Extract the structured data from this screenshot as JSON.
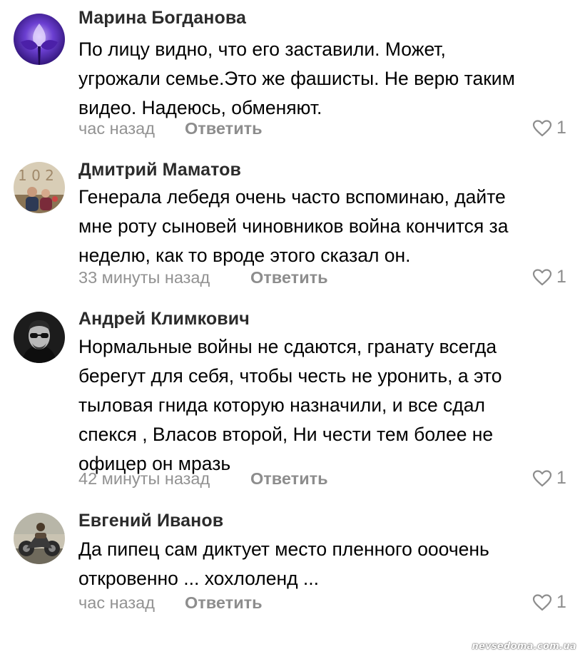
{
  "comments": [
    {
      "author": "Марина Богданова",
      "avatar": "iris-flower-avatar",
      "text_lines": [
        "По лицу видно, что его заставили. Может,",
        "угрожали семье.Это же фашисты. Не верю таким",
        "видео. Надеюсь, обменяют."
      ],
      "time": "час назад",
      "reply_label": "Ответить",
      "likes": "1"
    },
    {
      "author": "Дмитрий Маматов",
      "avatar": "couple-photo-avatar",
      "text_lines": [
        "Генерала лебедя очень часто вспоминаю, дайте",
        "мне роту сыновей чиновников война кончится за",
        "неделю, как то вроде этого сказал он."
      ],
      "time": "33 минуты назад",
      "reply_label": "Ответить",
      "likes": "1"
    },
    {
      "author": "Андрей Климкович",
      "avatar": "man-sunglasses-avatar",
      "text_lines": [
        "Нормальные войны не сдаются, гранату всегда",
        "берегут для себя, чтобы честь не уронить, а это",
        "тыловая гнида которую назначили, и все сдал",
        "спекся , Власов второй, Ни чести тем более не",
        "офицер он мразь"
      ],
      "time": "42 минуты назад",
      "reply_label": "Ответить",
      "likes": "1"
    },
    {
      "author": "Евгений Иванов",
      "avatar": "motorcycle-avatar",
      "text_lines": [
        "Да пипец сам диктует место пленного ооочень",
        "откровенно ... хохлоленд ..."
      ],
      "time": "час назад",
      "reply_label": "Ответить",
      "likes": "1"
    }
  ],
  "watermark": "nevsedoma.com.ua",
  "colors": {
    "text": "#000000",
    "author": "#2b2b2b",
    "meta": "#929292",
    "reply": "#8d8d8d",
    "heart": "#8d8d8d"
  }
}
